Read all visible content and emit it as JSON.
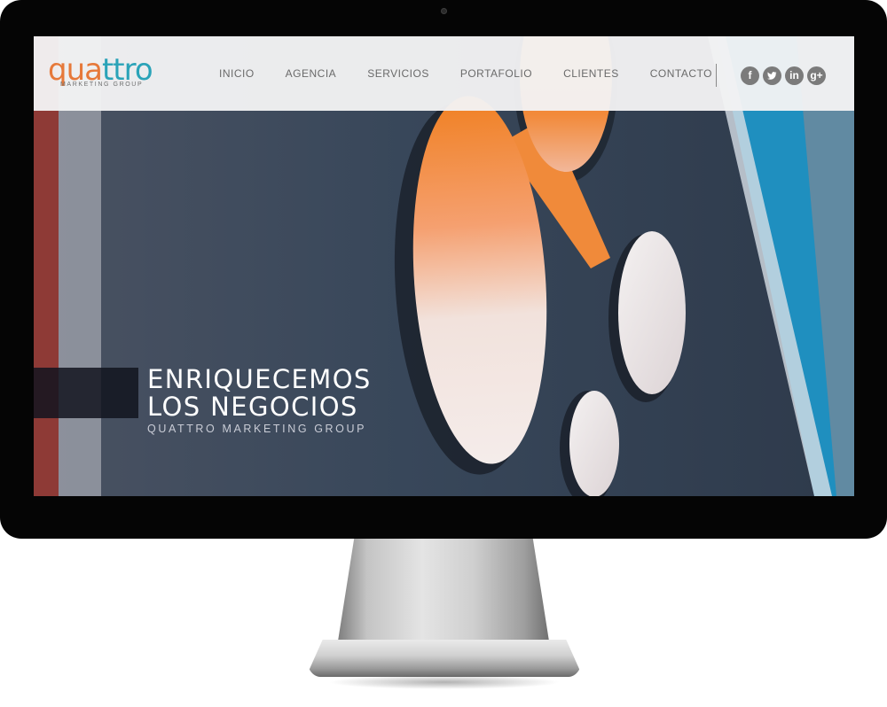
{
  "header": {
    "logo": {
      "word_part1": "qua",
      "word_part2": "ttro",
      "tagline": "MARKETING GROUP"
    },
    "nav": [
      "INICIO",
      "AGENCIA",
      "SERVICIOS",
      "PORTAFOLIO",
      "CLIENTES",
      "CONTACTO"
    ],
    "social": [
      {
        "name": "facebook-icon",
        "glyph": "f"
      },
      {
        "name": "twitter-icon",
        "glyph": ""
      },
      {
        "name": "linkedin-icon",
        "glyph": "in"
      },
      {
        "name": "google-plus-icon",
        "glyph": "g+"
      }
    ]
  },
  "hero": {
    "line1": "ENRIQUECEMOS",
    "line2": "LOS NEGOCIOS",
    "subtitle": "QUATTRO MARKETING GROUP"
  },
  "colors": {
    "brand_orange": "#e6793a",
    "brand_teal": "#2aa3b8",
    "wall": "#3a4656",
    "accent_blue": "#1f8fbf"
  }
}
